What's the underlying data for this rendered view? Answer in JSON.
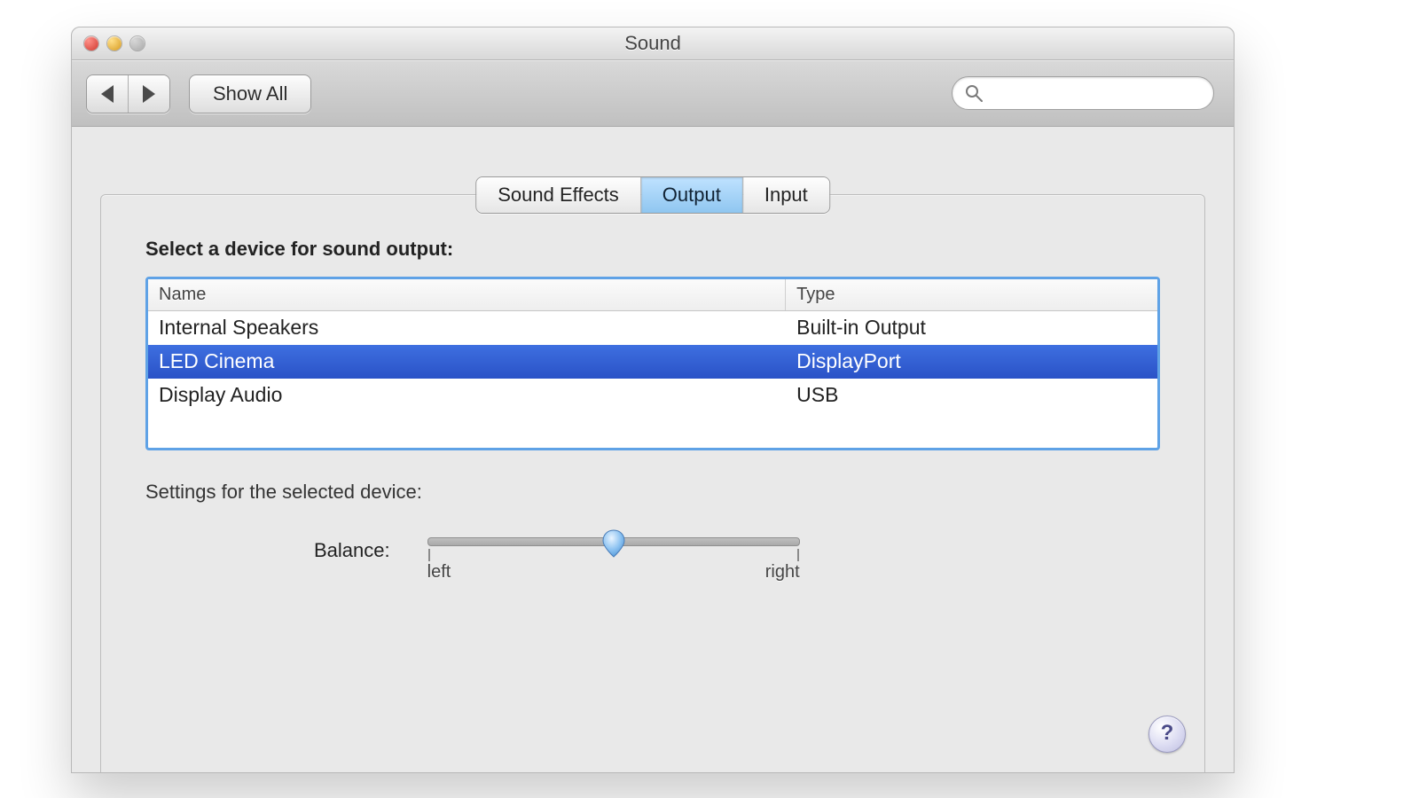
{
  "window": {
    "title": "Sound"
  },
  "toolbar": {
    "show_all": "Show All",
    "search_placeholder": ""
  },
  "tabs": [
    {
      "label": "Sound Effects",
      "active": false
    },
    {
      "label": "Output",
      "active": true
    },
    {
      "label": "Input",
      "active": false
    }
  ],
  "select_device_label": "Select a device for sound output:",
  "columns": {
    "name": "Name",
    "type": "Type"
  },
  "devices": [
    {
      "name": "Internal Speakers",
      "type": "Built-in Output",
      "selected": false
    },
    {
      "name": "LED Cinema",
      "type": "DisplayPort",
      "selected": true
    },
    {
      "name": "Display Audio",
      "type": "USB",
      "selected": false
    }
  ],
  "settings_label": "Settings for the selected device:",
  "balance": {
    "label": "Balance:",
    "left": "left",
    "right": "right",
    "value": 0.5
  },
  "help_symbol": "?"
}
